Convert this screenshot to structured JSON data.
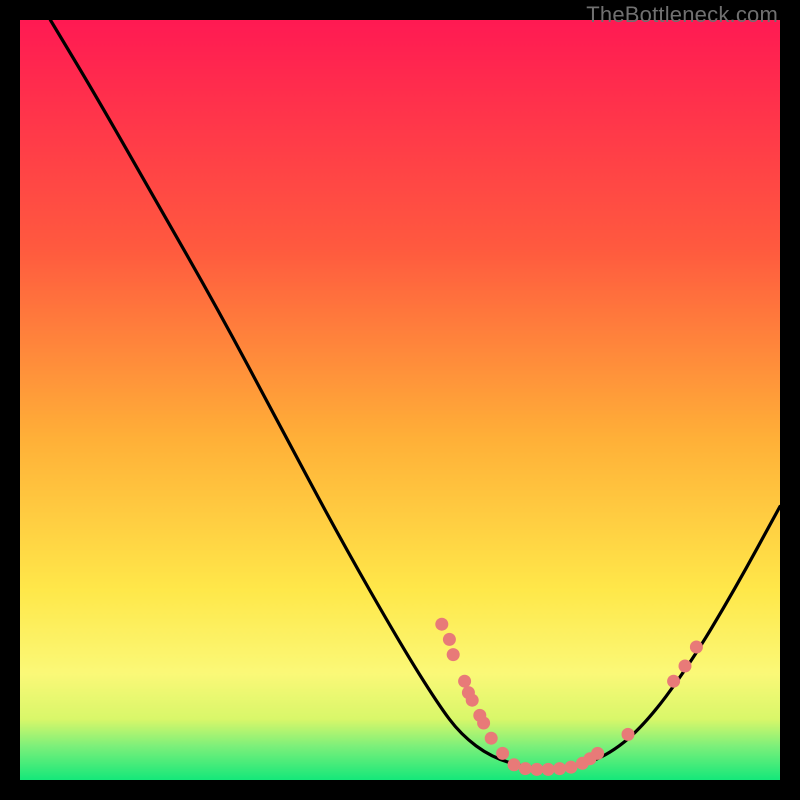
{
  "watermark": "TheBottleneck.com",
  "colors": {
    "bg": "#000000",
    "grad_top": "#ff1a53",
    "grad_mid1": "#ff6b3d",
    "grad_mid2": "#ffc233",
    "grad_mid3": "#fff04a",
    "grad_bottom": "#15e87a",
    "curve": "#000000",
    "marker": "#e87a78"
  },
  "chart_data": {
    "type": "line",
    "title": "",
    "xlabel": "",
    "ylabel": "",
    "xlim": [
      0,
      100
    ],
    "ylim": [
      0,
      100
    ],
    "curve": [
      {
        "x": 4,
        "y": 100
      },
      {
        "x": 10,
        "y": 90
      },
      {
        "x": 18,
        "y": 76
      },
      {
        "x": 26,
        "y": 62
      },
      {
        "x": 34,
        "y": 47
      },
      {
        "x": 42,
        "y": 32
      },
      {
        "x": 50,
        "y": 18
      },
      {
        "x": 55,
        "y": 10
      },
      {
        "x": 58,
        "y": 6
      },
      {
        "x": 62,
        "y": 3
      },
      {
        "x": 67,
        "y": 1.5
      },
      {
        "x": 72,
        "y": 1.5
      },
      {
        "x": 77,
        "y": 3
      },
      {
        "x": 82,
        "y": 7
      },
      {
        "x": 88,
        "y": 15
      },
      {
        "x": 94,
        "y": 25
      },
      {
        "x": 100,
        "y": 36
      }
    ],
    "markers": [
      {
        "x": 55.5,
        "y": 20.5
      },
      {
        "x": 56.5,
        "y": 18.5
      },
      {
        "x": 57.0,
        "y": 16.5
      },
      {
        "x": 58.5,
        "y": 13.0
      },
      {
        "x": 59.0,
        "y": 11.5
      },
      {
        "x": 59.5,
        "y": 10.5
      },
      {
        "x": 60.5,
        "y": 8.5
      },
      {
        "x": 61.0,
        "y": 7.5
      },
      {
        "x": 62.0,
        "y": 5.5
      },
      {
        "x": 63.5,
        "y": 3.5
      },
      {
        "x": 65.0,
        "y": 2.0
      },
      {
        "x": 66.5,
        "y": 1.5
      },
      {
        "x": 68.0,
        "y": 1.4
      },
      {
        "x": 69.5,
        "y": 1.4
      },
      {
        "x": 71.0,
        "y": 1.5
      },
      {
        "x": 72.5,
        "y": 1.7
      },
      {
        "x": 74.0,
        "y": 2.2
      },
      {
        "x": 75.0,
        "y": 2.8
      },
      {
        "x": 76.0,
        "y": 3.5
      },
      {
        "x": 80.0,
        "y": 6.0
      },
      {
        "x": 86.0,
        "y": 13.0
      },
      {
        "x": 87.5,
        "y": 15.0
      },
      {
        "x": 89.0,
        "y": 17.5
      }
    ]
  }
}
